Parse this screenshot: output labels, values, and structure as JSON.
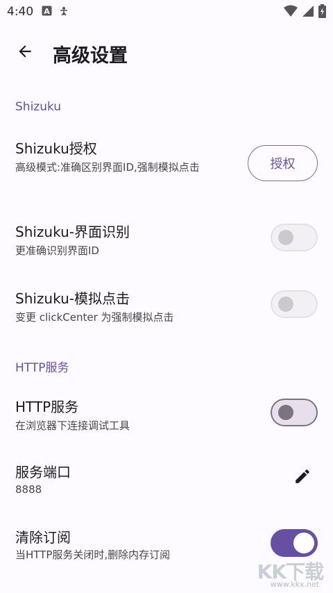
{
  "status_bar": {
    "time": "4:40",
    "icons": [
      "a-notification-icon",
      "accessibility-icon",
      "wifi-icon",
      "signal-icon",
      "battery-charging-icon"
    ]
  },
  "app_bar": {
    "back_icon": "arrow-back-icon",
    "title": "高级设置"
  },
  "sections": {
    "shizuku": {
      "header": "Shizuku",
      "authorize": {
        "title": "Shizuku授权",
        "subtitle": "高级模式:准确区别界面ID,强制模拟点击",
        "button_label": "授权"
      },
      "ui_recognition": {
        "title": "Shizuku-界面识别",
        "subtitle": "更准确识别界面ID",
        "enabled": false
      },
      "simulate_click": {
        "title": "Shizuku-模拟点击",
        "subtitle": "变更 clickCenter 为强制模拟点击",
        "enabled": false
      }
    },
    "http": {
      "header": "HTTP服务",
      "http_service": {
        "title": "HTTP服务",
        "subtitle": "在浏览器下连接调试工具",
        "enabled": false
      },
      "port": {
        "title": "服务端口",
        "value": "8888",
        "edit_icon": "edit-pencil-icon"
      },
      "clear_subscriptions": {
        "title": "清除订阅",
        "subtitle": "当HTTP服务关闭时,删除内存订阅",
        "enabled": true
      }
    }
  },
  "colors": {
    "accent": "#6750a4",
    "background": "#fdfbff",
    "text_primary": "#1c1b1f",
    "text_secondary": "#49454f"
  },
  "watermark": {
    "text": "KK下载",
    "url": "www.kkx.net"
  }
}
